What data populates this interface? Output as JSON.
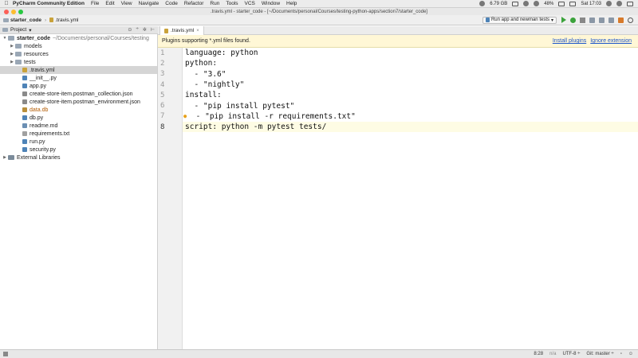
{
  "menubar": {
    "app_name": "PyCharm Community Edition",
    "items": [
      "File",
      "Edit",
      "View",
      "Navigate",
      "Code",
      "Refactor",
      "Run",
      "Tools",
      "VCS",
      "Window",
      "Help"
    ],
    "status": {
      "disk": "6.79 GB",
      "battery": "48%",
      "clock": "Sat 17:03"
    }
  },
  "window": {
    "title": ".travis.yml - starter_code - [~/Documents/personal/Courses/testing-python-apps/section7/starter_code]"
  },
  "navbar": {
    "crumb_project": "starter_code",
    "crumb_file": ".travis.yml",
    "run_config": "Run app and newman tests"
  },
  "project_panel": {
    "title": "Project",
    "tree": [
      {
        "label": "starter_code",
        "suffix": "~/Documents/personal/Courses/testing",
        "icon": "folder",
        "arrow": "▼",
        "indent": 0,
        "bold": true
      },
      {
        "label": "models",
        "icon": "folder",
        "arrow": "▶",
        "indent": 1
      },
      {
        "label": "resources",
        "icon": "folder",
        "arrow": "▶",
        "indent": 1
      },
      {
        "label": "tests",
        "icon": "folder",
        "arrow": "▶",
        "indent": 1
      },
      {
        "label": ".travis.yml",
        "icon": "yml",
        "indent": 2,
        "selected": true
      },
      {
        "label": "__init__.py",
        "icon": "py",
        "indent": 2
      },
      {
        "label": "app.py",
        "icon": "py",
        "indent": 2
      },
      {
        "label": "create-store-item.postman_collection.json",
        "icon": "json",
        "indent": 2
      },
      {
        "label": "create-store-item.postman_environment.json",
        "icon": "json",
        "indent": 2
      },
      {
        "label": "data.db",
        "icon": "db",
        "indent": 2,
        "orange": true
      },
      {
        "label": "db.py",
        "icon": "py",
        "indent": 2
      },
      {
        "label": "readme.md",
        "icon": "md",
        "indent": 2
      },
      {
        "label": "requirements.txt",
        "icon": "txt",
        "indent": 2
      },
      {
        "label": "run.py",
        "icon": "py",
        "indent": 2
      },
      {
        "label": "security.py",
        "icon": "py",
        "indent": 2
      },
      {
        "label": "External Libraries",
        "icon": "lib",
        "arrow": "▶",
        "indent": 0
      }
    ]
  },
  "editor": {
    "tab_label": ".travis.yml",
    "notice_text": "Plugins supporting *.yml files found.",
    "notice_install": "Install plugins",
    "notice_ignore": "Ignore extension",
    "lines": [
      "language: python",
      "python:",
      "  - \"3.6\"",
      "  - \"nightly\"",
      "install:",
      "  - \"pip install pytest\"",
      "  - \"pip install -r requirements.txt\"",
      "script: python -m pytest tests/"
    ],
    "line_numbers": [
      "1",
      "2",
      "3",
      "4",
      "5",
      "6",
      "7",
      "8"
    ],
    "current_line": 8
  },
  "statusbar": {
    "position": "8:28",
    "na": "n/a",
    "encoding": "UTF-8 ÷",
    "git": "Git: master ÷"
  }
}
